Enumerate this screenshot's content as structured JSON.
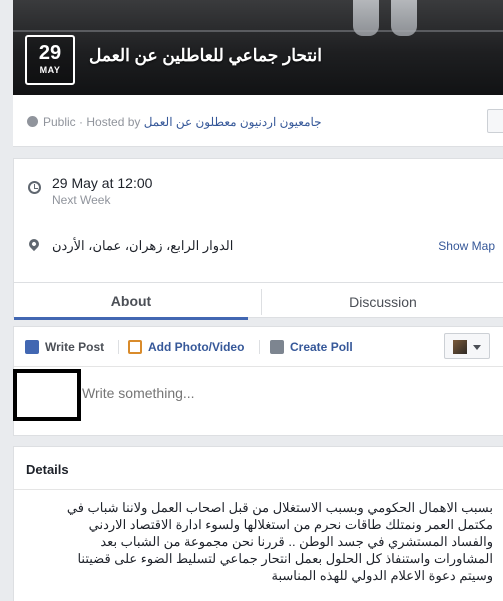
{
  "event": {
    "day": "29",
    "month": "MAY",
    "title": "انتحار جماعي للعاطلين عن العمل"
  },
  "host": {
    "visibility": "Public · Hosted by ",
    "name": "جامعيون اردنيون معطلون عن العمل"
  },
  "when": {
    "time": "29 May at 12:00",
    "relative": "Next Week"
  },
  "where": {
    "location": "الدوار الرابع، زهران، عمان، الأردن",
    "show_map": "Show Map"
  },
  "tabs": [
    {
      "label": "About"
    },
    {
      "label": "Discussion"
    }
  ],
  "composer": {
    "write_post": "Write Post",
    "add_photo": "Add Photo/Video",
    "create_poll": "Create Poll",
    "placeholder": "Write something..."
  },
  "details": {
    "heading": "Details",
    "lines": [
      "بسبب الاهمال الحكومي وبسبب الاستغلال من قبل اصحاب العمل ولاننا شباب في",
      "مكتمل العمر ونمتلك طاقات نحرم من استغلالها ولسوء ادارة الاقتصاد الاردني",
      "والفساد المستشري في جسد الوطن .. قررنا نحن مجموعة من الشباب بعد",
      "المشاورات واستنفاذ كل الحلول بعمل انتحار جماعي لتسليط الضوء على قضيتنا",
      "وسيتم دعوة الاعلام الدولي للهذه المناسبة"
    ]
  }
}
